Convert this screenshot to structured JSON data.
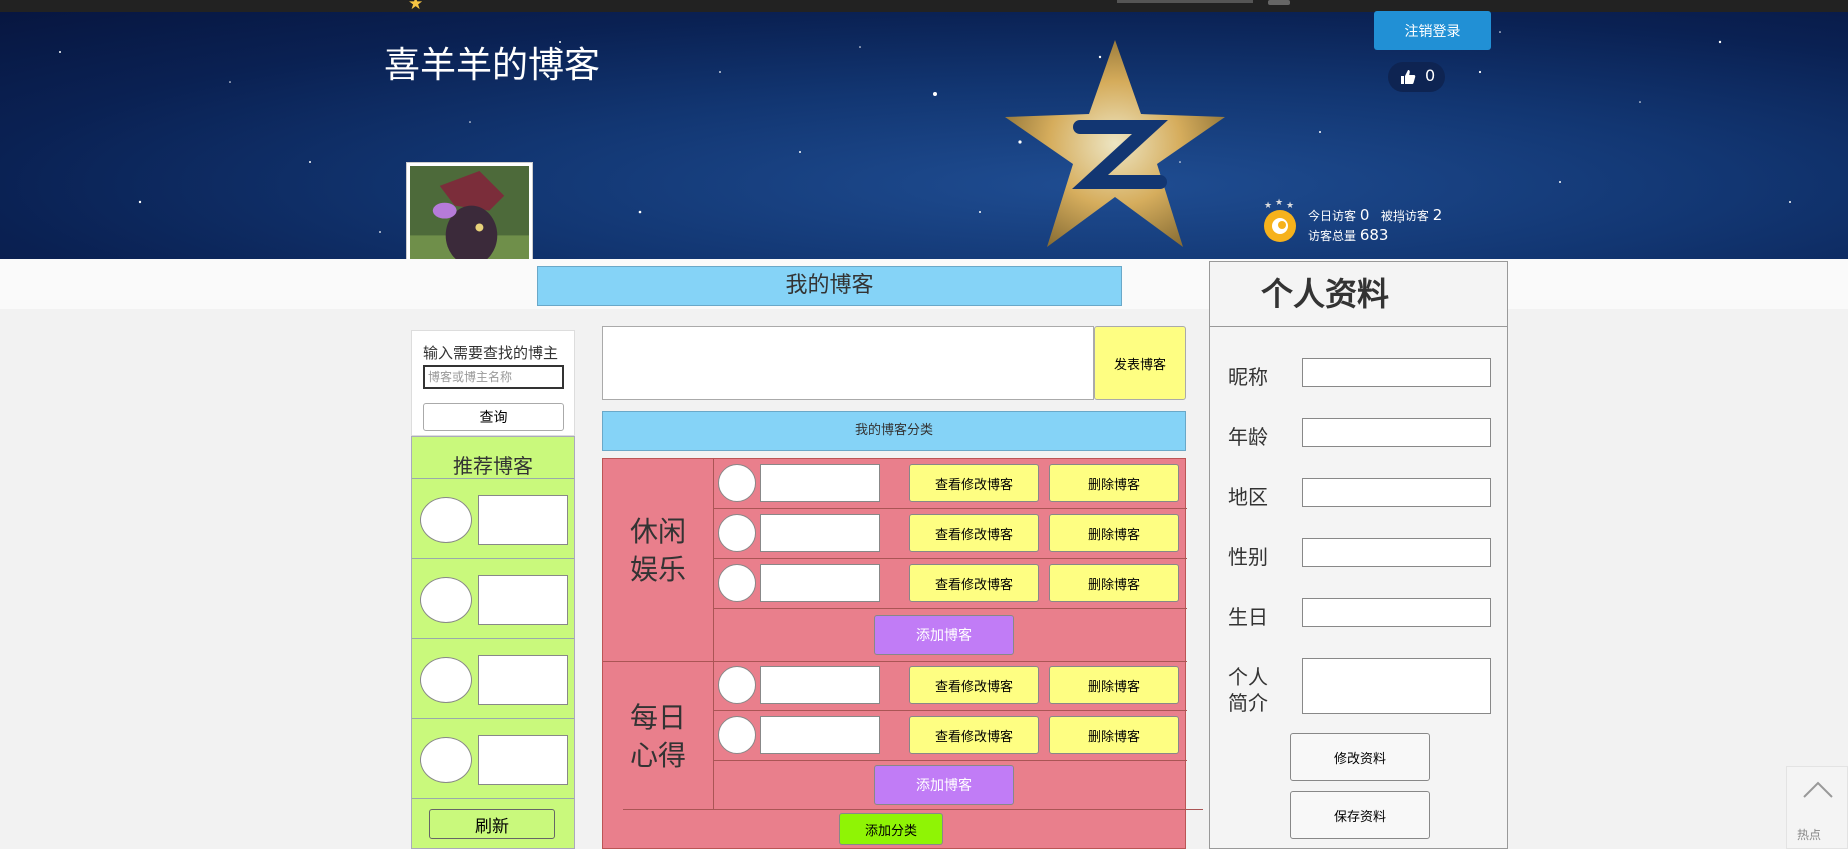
{
  "header": {
    "blog_title": "喜羊羊的博客",
    "logout_label": "注销登录",
    "like_count": "0"
  },
  "visitors": {
    "today_label": "今日访客",
    "today_value": "0",
    "blocked_label": "被挡访客",
    "blocked_value": "2",
    "total_label": "访客总量",
    "total_value": "683"
  },
  "main": {
    "title": "我的博客",
    "publish_label": "发表博客",
    "category_header": "我的博客分类",
    "edit_label": "查看修改博客",
    "delete_label": "删除博客",
    "add_blog_label": "添加博客",
    "add_category_label": "添加分类",
    "categories": [
      {
        "name_line1": "休闲",
        "name_line2": "娱乐",
        "entries": 3
      },
      {
        "name_line1": "每日",
        "name_line2": "心得",
        "entries": 2
      }
    ]
  },
  "sidebar": {
    "search_label": "输入需要查找的博主",
    "search_placeholder": "博客或博主名称",
    "query_label": "查询",
    "recommend_title": "推荐博客",
    "refresh_label": "刷新"
  },
  "profile": {
    "title": "个人资料",
    "nickname_label": "昵称",
    "age_label": "年龄",
    "region_label": "地区",
    "gender_label": "性别",
    "birthday_label": "生日",
    "bio_label_line1": "个人",
    "bio_label_line2": "简介",
    "modify_label": "修改资料",
    "save_label": "保存资料"
  },
  "scroll_top": {
    "hot_label": "热点"
  },
  "colors": {
    "accent_blue": "#85d3f7",
    "category_red": "#e97f8c",
    "button_yellow": "#fefe82",
    "add_purple": "#c17cf6",
    "add_green": "#8ff405",
    "recommend_green": "#c9f97c",
    "logout_blue": "#2190d5"
  },
  "icons": [
    "star-icon",
    "thumb-up-icon",
    "visitor-badge-icon",
    "scroll-up-icon"
  ]
}
